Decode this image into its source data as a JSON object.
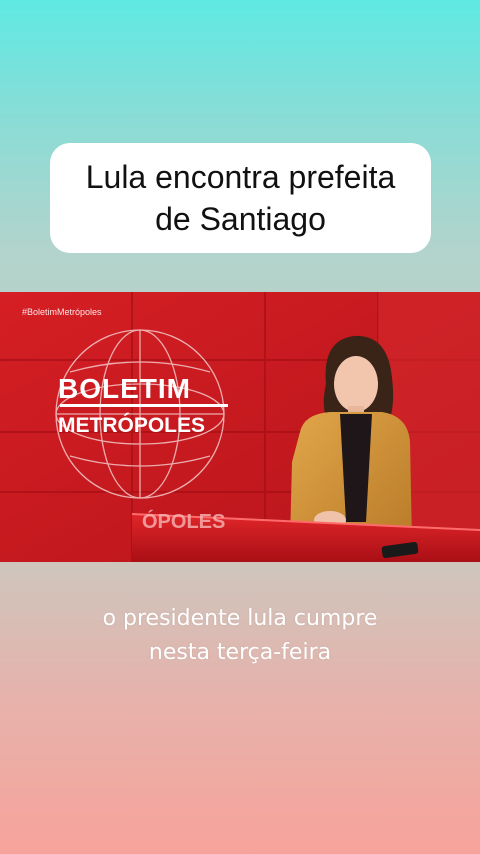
{
  "title_card": {
    "text": "Lula encontra prefeita\nde Santiago"
  },
  "video": {
    "hashtag": "#BoletimMetrópoles",
    "logo_line1": "BOLETIM",
    "logo_line2": "METRÓPOLES",
    "desk_text": "ÓPOLES"
  },
  "caption": {
    "text": "o presidente lula cumpre\nnesta terça-feira"
  },
  "colors": {
    "studio_red": "#c8181d",
    "blazer": "#d69a3c"
  }
}
